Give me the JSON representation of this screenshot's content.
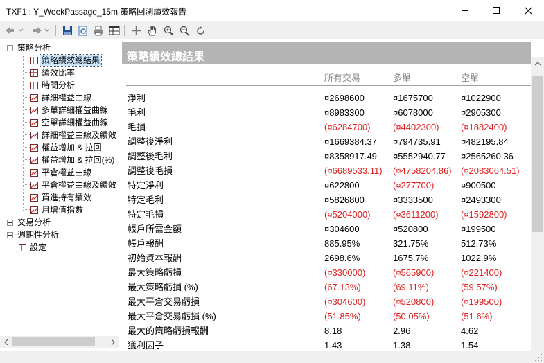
{
  "window": {
    "title": "TXF1 : Y_WeekPassage_15m 策略回測績效報告",
    "minimize_icon": "minimize-icon",
    "maximize_icon": "maximize-icon",
    "close_icon": "close-icon"
  },
  "toolbar": {
    "icons": [
      "back-icon",
      "forward-icon",
      "save-icon",
      "preview-icon",
      "print-icon",
      "table-icon",
      "crosshair-icon",
      "hand-icon",
      "zoom-in-icon",
      "zoom-out-icon",
      "refresh-icon"
    ]
  },
  "tree": {
    "groups": [
      {
        "label": "策略分析",
        "expanded": true
      },
      {
        "label": "交易分析",
        "expanded": false
      },
      {
        "label": "週期性分析",
        "expanded": false
      }
    ],
    "items": [
      {
        "label": "策略績效總結果",
        "icon": "grid-icon",
        "selected": true
      },
      {
        "label": "績效比率",
        "icon": "grid-icon"
      },
      {
        "label": "時間分析",
        "icon": "grid-icon"
      },
      {
        "label": "詳細權益曲線",
        "icon": "chart-icon"
      },
      {
        "label": "多單詳細權益曲線",
        "icon": "chart-icon"
      },
      {
        "label": "空單詳細權益曲線",
        "icon": "chart-icon"
      },
      {
        "label": "詳細權益曲線及績效",
        "icon": "chart-icon"
      },
      {
        "label": "權益增加 & 拉回",
        "icon": "chart-icon"
      },
      {
        "label": "權益增加 & 拉回(%)",
        "icon": "chart-icon"
      },
      {
        "label": "平倉權益曲線",
        "icon": "chart-icon"
      },
      {
        "label": "平倉權益曲線及績效",
        "icon": "chart-icon"
      },
      {
        "label": "買進持有績效",
        "icon": "chart-icon"
      },
      {
        "label": "月增值指數",
        "icon": "chart-icon"
      }
    ],
    "settings_label": "設定"
  },
  "report": {
    "title": "策略績效總結果",
    "columns": [
      "所有交易",
      "多單",
      "空單"
    ],
    "rows": [
      {
        "label": "淨利",
        "v": [
          "¤2698600",
          "¤1675700",
          "¤1022900"
        ],
        "neg": [
          false,
          false,
          false
        ]
      },
      {
        "label": "毛利",
        "v": [
          "¤8983300",
          "¤6078000",
          "¤2905300"
        ],
        "neg": [
          false,
          false,
          false
        ]
      },
      {
        "label": "毛損",
        "v": [
          "(¤6284700)",
          "(¤4402300)",
          "(¤1882400)"
        ],
        "neg": [
          true,
          true,
          true
        ]
      },
      {
        "label": "調整後淨利",
        "v": [
          "¤1669384.37",
          "¤794735.91",
          "¤482195.84"
        ],
        "neg": [
          false,
          false,
          false
        ]
      },
      {
        "label": "調整後毛利",
        "v": [
          "¤8358917.49",
          "¤5552940.77",
          "¤2565260.36"
        ],
        "neg": [
          false,
          false,
          false
        ]
      },
      {
        "label": "調整後毛損",
        "v": [
          "(¤6689533.11)",
          "(¤4758204.86)",
          "(¤2083064.51)"
        ],
        "neg": [
          true,
          true,
          true
        ]
      },
      {
        "label": "特定淨利",
        "v": [
          "¤622800",
          "(¤277700)",
          "¤900500"
        ],
        "neg": [
          false,
          true,
          false
        ]
      },
      {
        "label": "特定毛利",
        "v": [
          "¤5826800",
          "¤3333500",
          "¤2493300"
        ],
        "neg": [
          false,
          false,
          false
        ]
      },
      {
        "label": "特定毛損",
        "v": [
          "(¤5204000)",
          "(¤3611200)",
          "(¤1592800)"
        ],
        "neg": [
          true,
          true,
          true
        ]
      },
      {
        "label": "帳戶所需金額",
        "v": [
          "¤304600",
          "¤520800",
          "¤199500"
        ],
        "neg": [
          false,
          false,
          false
        ]
      },
      {
        "label": "帳戶報酬",
        "v": [
          "885.95%",
          "321.75%",
          "512.73%"
        ],
        "neg": [
          false,
          false,
          false
        ]
      },
      {
        "label": "初始資本報酬",
        "v": [
          "2698.6%",
          "1675.7%",
          "1022.9%"
        ],
        "neg": [
          false,
          false,
          false
        ]
      },
      {
        "label": "最大策略虧損",
        "v": [
          "(¤330000)",
          "(¤565900)",
          "(¤221400)"
        ],
        "neg": [
          true,
          true,
          true
        ]
      },
      {
        "label": "最大策略虧損 (%)",
        "v": [
          "(67.13%)",
          "(69.11%)",
          "(59.57%)"
        ],
        "neg": [
          true,
          true,
          true
        ]
      },
      {
        "label": "最大平倉交易虧損",
        "v": [
          "(¤304600)",
          "(¤520800)",
          "(¤199500)"
        ],
        "neg": [
          true,
          true,
          true
        ]
      },
      {
        "label": "最大平倉交易虧損 (%)",
        "v": [
          "(51.85%)",
          "(50.05%)",
          "(51.6%)"
        ],
        "neg": [
          true,
          true,
          true
        ]
      },
      {
        "label": "最大的策略虧損報酬",
        "v": [
          "8.18",
          "2.96",
          "4.62"
        ],
        "neg": [
          false,
          false,
          false
        ]
      },
      {
        "label": "獲利因子",
        "v": [
          "1.43",
          "1.38",
          "1.54"
        ],
        "neg": [
          false,
          false,
          false
        ]
      }
    ]
  },
  "colors": {
    "negative": "#e02020",
    "header_bar": "#b4b4b4",
    "selection": "#cce8ff"
  }
}
